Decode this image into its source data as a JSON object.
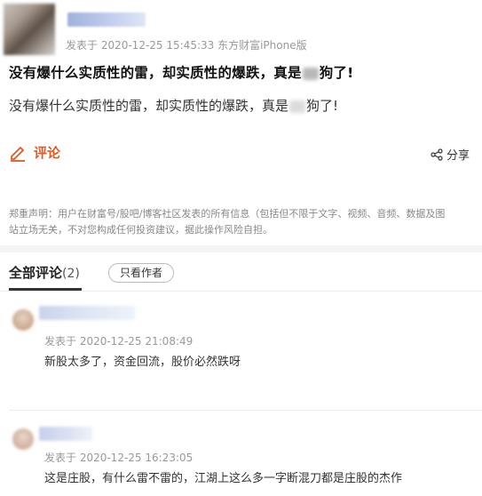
{
  "post": {
    "meta": "发表于 2020-12-25 15:45:33 东方财富iPhone版",
    "title_part1": "没有爆什么实质性的雷，却实质性的爆跌，真是",
    "title_part2": "狗了!",
    "body_part1": "没有爆什么实质性的雷，却实质性的爆跌，真是",
    "body_part2": "狗了!"
  },
  "actions": {
    "comment_label": "评论",
    "share_label": "分享",
    "accent_color": "#e2591f"
  },
  "disclaimer": {
    "line1": "郑重声明：用户在财富号/股吧/博客社区发表的所有信息（包括但不限于文字、视频、音频、数据及图",
    "line2": "站立场无关，不对您构成任何投资建议，据此操作风险自担。"
  },
  "comments_section": {
    "tab_label": "全部评论",
    "count": "(2)",
    "author_only_label": "只看作者"
  },
  "comments": [
    {
      "meta": "发表于 2020-12-25 21:08:49",
      "text": "新股太多了，资金回流，股价必然跌呀"
    },
    {
      "meta": "发表于 2020-12-25 16:23:05",
      "text": "这是庄股，有什么雷不雷的，江湖上这么多一字断混刀都是庄股的杰作"
    }
  ]
}
